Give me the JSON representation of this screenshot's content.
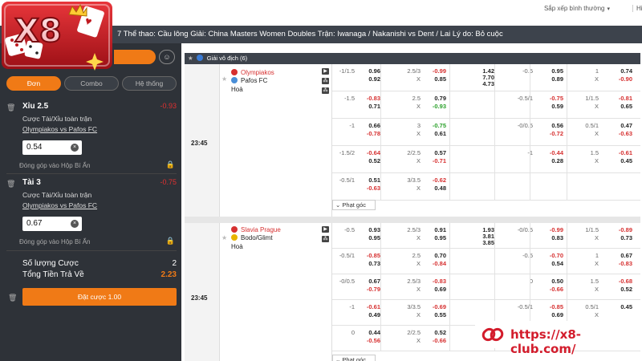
{
  "top": {
    "sort_label": "Sắp xếp bình thường",
    "right_label": "Hiển",
    "match_title": "7 Thể thao: Cầu lông Giải: China Masters Women Doubles Trận: Iwanaga / Nakanishi vs Dent / Lai Lý do: Bỏ cuộc"
  },
  "colors": {
    "accent": "#f07a16",
    "dark_panel": "#2e3238",
    "negative": "#d63030",
    "positive": "#2aa02a",
    "brand_red": "#d31c2c"
  },
  "sidebar": {
    "tabs": [
      {
        "label": "Đơn",
        "active": true
      },
      {
        "label": "Combo",
        "active": false
      },
      {
        "label": "Hệ thống",
        "active": false
      }
    ],
    "bets": [
      {
        "name": "Xỉu 2.5",
        "odd": "-0.93",
        "type": "Cược Tài/Xỉu toàn trận",
        "match": "Olympiakos vs Pafos FC",
        "stake": "0.54",
        "hide_label": "Đóng góp vào Hộp Bí Ẩn"
      },
      {
        "name": "Tài 3",
        "odd": "-0.75",
        "type": "Cược Tài/Xỉu toàn trận",
        "match": "Olympiakos vs Pafos FC",
        "stake": "0.67",
        "hide_label": "Đóng góp vào Hộp Bí Ẩn"
      }
    ],
    "summary": {
      "count_label": "Số lượng Cược",
      "count_value": "2",
      "total_label": "Tổng Tiền Trả Về",
      "total_value": "2.23"
    },
    "place_label": "Đặt cược 1.00"
  },
  "board": {
    "league": "Giải vô địch (6)",
    "more_label": "Phạt góc",
    "matches": [
      {
        "time": "23:45",
        "home": "Olympiakos",
        "away": "Pafos FC",
        "draw": "Hoà",
        "rows": [
          [
            "-1/1.5",
            "0.96",
            "0.92",
            "2.5/3",
            "-0.99",
            "0.85",
            "1.42",
            "7.70",
            "4.73",
            "-0.5",
            "0.95",
            "0.89",
            "1",
            "0.74",
            "-0.90"
          ],
          [
            "-1.5",
            "-0.83",
            "0.71",
            "2.5",
            "0.79",
            "-0.93",
            "",
            "",
            "",
            "-0.5/1",
            "-0.75",
            "0.59",
            "1/1.5",
            "-0.81",
            "0.65"
          ],
          [
            "-1",
            "0.66",
            "-0.78",
            "3",
            "-0.75",
            "0.61",
            "",
            "",
            "",
            "-0/0.5",
            "0.56",
            "-0.72",
            "0.5/1",
            "0.47",
            "-0.63"
          ],
          [
            "-1.5/2",
            "-0.64",
            "0.52",
            "2/2.5",
            "0.57",
            "-0.71",
            "",
            "",
            "",
            "-1",
            "-0.44",
            "0.28",
            "1.5",
            "-0.61",
            "0.45"
          ],
          [
            "-0.5/1",
            "0.51",
            "-0.63",
            "3/3.5",
            "-0.62",
            "0.48",
            "",
            "",
            "",
            "",
            "",
            "",
            "",
            "",
            ""
          ]
        ]
      },
      {
        "time": "23:45",
        "home": "Slavia Prague",
        "away": "Bodo/Glimt",
        "draw": "Hoà",
        "rows": [
          [
            "-0.5",
            "0.93",
            "0.95",
            "2.5/3",
            "0.91",
            "0.95",
            "1.93",
            "3.81",
            "3.85",
            "-0/0.5",
            "-0.99",
            "0.83",
            "1/1.5",
            "-0.89",
            "0.73"
          ],
          [
            "-0.5/1",
            "-0.85",
            "0.73",
            "2.5",
            "0.70",
            "-0.84",
            "",
            "",
            "",
            "-0.5",
            "-0.70",
            "0.54",
            "1",
            "0.67",
            "-0.83"
          ],
          [
            "-0/0.5",
            "0.67",
            "-0.79",
            "2.5/3",
            "-0.83",
            "0.69",
            "",
            "",
            "",
            "0",
            "0.50",
            "-0.66",
            "1.5",
            "-0.68",
            "0.52"
          ],
          [
            "-1",
            "-0.61",
            "0.49",
            "3/3.5",
            "-0.69",
            "0.55",
            "",
            "",
            "",
            "-0.5/1",
            "-0.85",
            "0.69",
            "0.5/1",
            "0.45",
            ""
          ],
          [
            "0",
            "0.44",
            "-0.56",
            "2/2.5",
            "0.52",
            "-0.66",
            "",
            "",
            "",
            "",
            "",
            "",
            "",
            "",
            ""
          ]
        ]
      }
    ]
  },
  "footer_url": "https://x8-club.com/"
}
